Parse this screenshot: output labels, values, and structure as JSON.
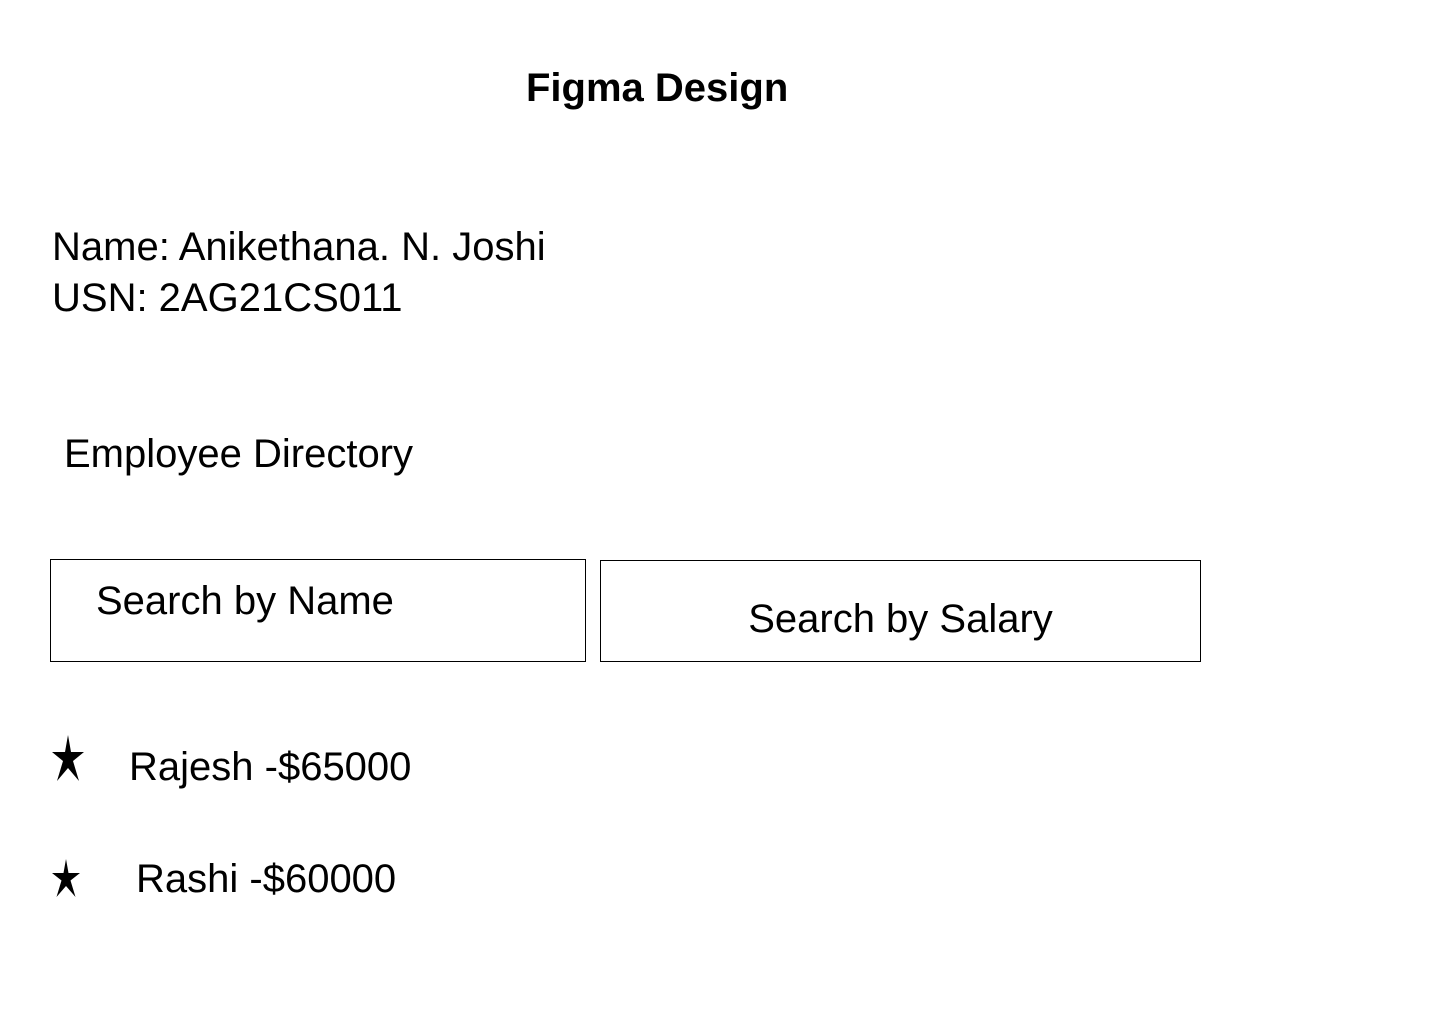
{
  "page": {
    "title": "Figma Design"
  },
  "student": {
    "name_line": "Name: Anikethana. N. Joshi",
    "usn_line": "USN: 2AG21CS011"
  },
  "directory": {
    "heading": "Employee Directory",
    "search_name": {
      "value": "",
      "placeholder": "Search by Name"
    },
    "search_salary": {
      "value": "",
      "placeholder": "Search by Salary"
    },
    "employees": [
      {
        "label": "Rajesh -$65000",
        "icon": "star-icon"
      },
      {
        "label": "Rashi -$60000",
        "icon": "star-icon"
      }
    ]
  },
  "colors": {
    "text": "#000000",
    "background": "#ffffff",
    "border": "#000000"
  }
}
